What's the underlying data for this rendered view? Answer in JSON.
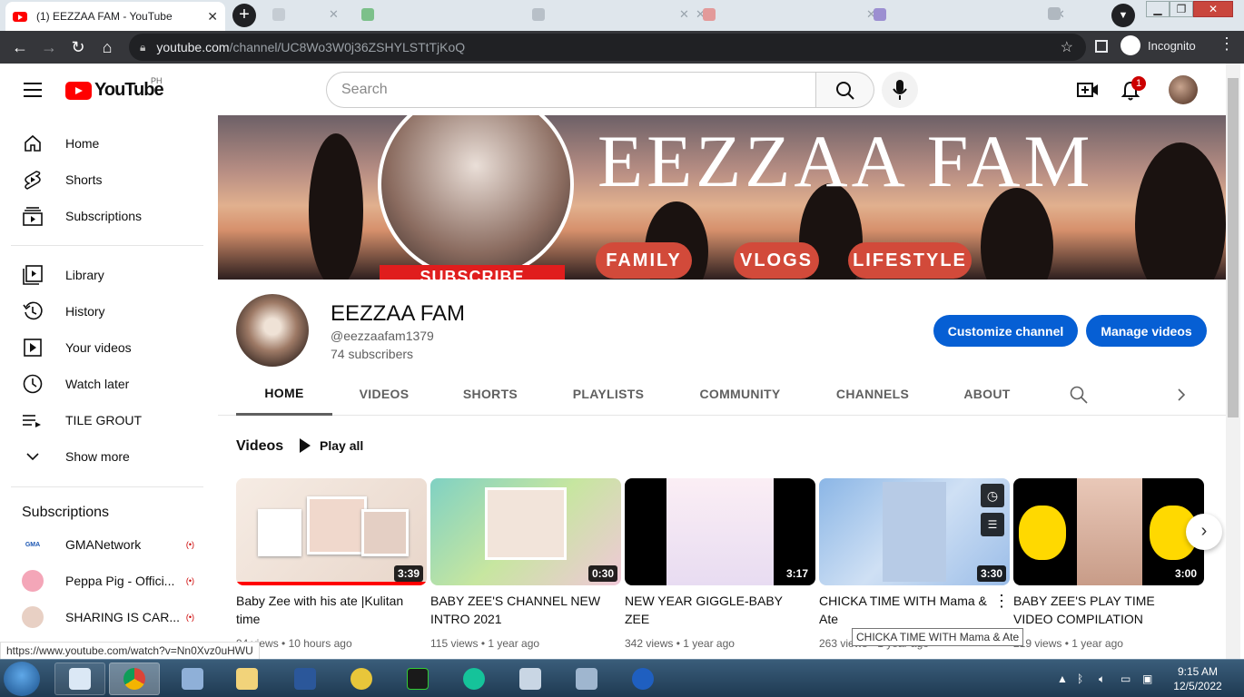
{
  "browser": {
    "active_tab_title": "(1) EEZZAA FAM - YouTube",
    "background_tabs": [
      "",
      "",
      "",
      "",
      "",
      ""
    ],
    "url_host": "youtube.com",
    "url_path": "/channel/UC8Wo3W0j36ZSHYLSTtTjKoQ",
    "profile_label": "Incognito",
    "status_url": "https://www.youtube.com/watch?v=Nn0Xvz0uHWU"
  },
  "header": {
    "logo_text": "YouTube",
    "country_code": "PH",
    "search_placeholder": "Search",
    "notification_count": "1"
  },
  "sidebar": {
    "primary": [
      {
        "label": "Home",
        "icon": "home-icon"
      },
      {
        "label": "Shorts",
        "icon": "shorts-icon"
      },
      {
        "label": "Subscriptions",
        "icon": "subscriptions-icon"
      }
    ],
    "secondary": [
      {
        "label": "Library",
        "icon": "library-icon"
      },
      {
        "label": "History",
        "icon": "history-icon"
      },
      {
        "label": "Your videos",
        "icon": "your-videos-icon"
      },
      {
        "label": "Watch later",
        "icon": "watch-later-icon"
      },
      {
        "label": "TILE GROUT",
        "icon": "playlist-icon"
      },
      {
        "label": "Show more",
        "icon": "chevron-down-icon"
      }
    ],
    "subscriptions_heading": "Subscriptions",
    "subscriptions": [
      {
        "label": "GMANetwork",
        "avatar_text": "GMA"
      },
      {
        "label": "Peppa Pig - Offici...",
        "avatar_text": ""
      },
      {
        "label": "SHARING IS CAR...",
        "avatar_text": ""
      }
    ]
  },
  "banner": {
    "title": "EEZZAA FAM",
    "pills": [
      "FAMILY",
      "VLOGS",
      "LIFESTYLE"
    ],
    "subscribe_text": "SUBSCRIBE"
  },
  "channel": {
    "name": "EEZZAA FAM",
    "handle": "@eezzaafam1379",
    "subscribers": "74 subscribers",
    "customize_label": "Customize channel",
    "manage_label": "Manage videos",
    "tabs": [
      "HOME",
      "VIDEOS",
      "SHORTS",
      "PLAYLISTS",
      "COMMUNITY",
      "CHANNELS",
      "ABOUT"
    ],
    "active_tab": "HOME"
  },
  "videos_section": {
    "title": "Videos",
    "play_all": "Play all",
    "tooltip": "CHICKA TIME WITH Mama & Ate",
    "items": [
      {
        "title": "Baby Zee with his ate |Kulitan time",
        "duration": "3:39",
        "views": "94 views",
        "age": "10 hours ago"
      },
      {
        "title": "BABY ZEE'S CHANNEL NEW INTRO 2021",
        "duration": "0:30",
        "views": "115 views",
        "age": "1 year ago"
      },
      {
        "title": "NEW YEAR GIGGLE-BABY ZEE",
        "duration": "3:17",
        "views": "342 views",
        "age": "1 year ago"
      },
      {
        "title": "CHICKA TIME WITH Mama & Ate",
        "duration": "3:30",
        "views": "263 views",
        "age": "1 year ago"
      },
      {
        "title": "BABY ZEE'S PLAY TIME VIDEO COMPILATION",
        "duration": "3:00",
        "views": "219 views",
        "age": "1 year ago"
      }
    ]
  },
  "taskbar": {
    "time": "9:15 AM",
    "date": "12/5/2022"
  },
  "colors": {
    "youtube_red": "#ff0000",
    "button_blue": "#065fd4",
    "banner_pill": "#d24a3a"
  }
}
